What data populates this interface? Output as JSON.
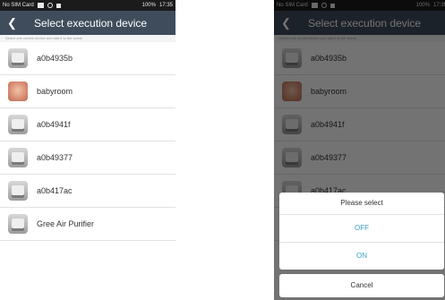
{
  "status": {
    "carrier": "No SIM Card",
    "battery": "100%",
    "time": "17:35"
  },
  "header": {
    "back_icon": "chevron-left-icon",
    "title": "Select execution device"
  },
  "hint": "Select one control device and add it to the scene",
  "devices": [
    {
      "label": "a0b4935b",
      "icon": "device-icon"
    },
    {
      "label": "babyroom",
      "icon": "baby-photo-icon"
    },
    {
      "label": "a0b4941f",
      "icon": "device-icon"
    },
    {
      "label": "a0b49377",
      "icon": "device-icon"
    },
    {
      "label": "a0b417ac",
      "icon": "device-icon"
    },
    {
      "label": "Gree Air Purifier",
      "icon": "device-icon"
    }
  ],
  "dialog": {
    "title": "Please select",
    "options": [
      "OFF",
      "ON"
    ],
    "cancel": "Cancel"
  },
  "colors": {
    "titlebar": "#3f4c5b",
    "option_text": "#3aa0c8",
    "overlay": "rgba(0,0,0,0.55)"
  }
}
